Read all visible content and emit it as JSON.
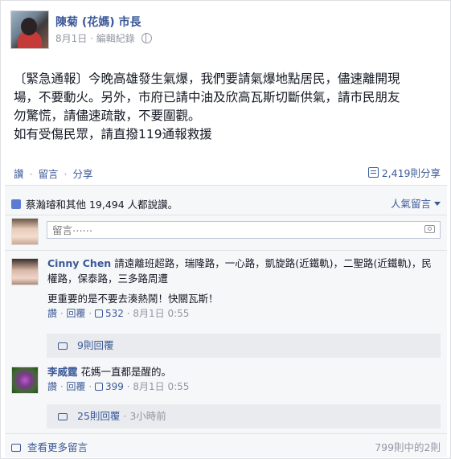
{
  "post": {
    "author": "陳菊 (花媽) 市長",
    "date": "8月1日",
    "meta_sep": "·",
    "edit_history": "編輯紀錄",
    "text_lines": [
      "〔緊急通報〕今晚高雄發生氣爆，我們要請氣爆地點居民，儘速離開現",
      "場，不要動火。另外，市府已請中油及欣高瓦斯切斷供氣，請市民朋友",
      "勿驚慌，請儘速疏散，不要圍觀。",
      "如有受傷民眾，請直撥119通報救援"
    ]
  },
  "actions": {
    "like": "讚",
    "sep": "·",
    "comment": "留言",
    "share": "分享",
    "share_count": "2,419則分享"
  },
  "likes_summary": {
    "text": "蔡瀚璿和其他 19,494 人都說讚。",
    "sort_label": "人氣留言"
  },
  "comment_input": {
    "placeholder": "留言⋯⋯"
  },
  "comments": [
    {
      "name": "Cinny Chen",
      "text": "請遠離班超路，瑞隆路，一心路，凱旋路(近鐵軌)，二聖路(近鐵軌)，民權路，保泰路，三多路周遭",
      "extra": "更重要的是不要去湊熱鬧！快關瓦斯！",
      "like_label": "讚",
      "reply_label": "回覆",
      "like_count": "532",
      "time": "8月1日 0:55",
      "replies": "9則回覆",
      "reply_time": ""
    },
    {
      "name": "李威霆",
      "text": "花媽一直都是醒的。",
      "extra": "",
      "like_label": "讚",
      "reply_label": "回覆",
      "like_count": "399",
      "time": "8月1日 0:55",
      "replies": "25則回覆",
      "reply_time": "3小時前"
    }
  ],
  "footer": {
    "view_more": "查看更多留言",
    "count": "799則中的2則"
  },
  "colors": {
    "link": "#3b5998",
    "meta": "#9197a3",
    "panel": "#f6f7f9"
  }
}
